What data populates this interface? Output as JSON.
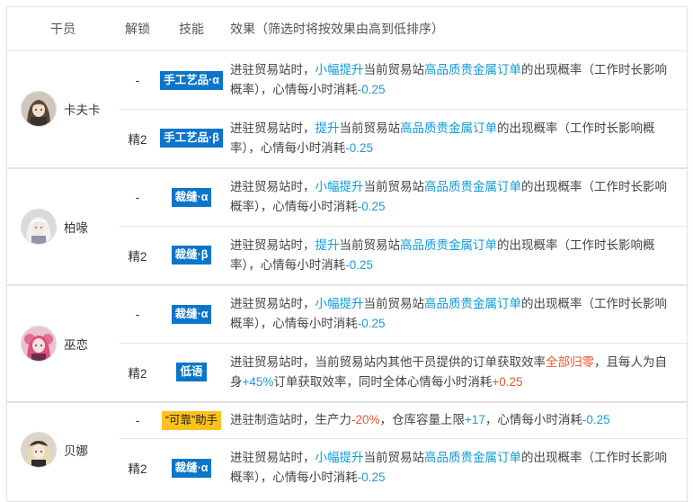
{
  "header": {
    "operator": "干员",
    "unlock": "解锁",
    "skill": "技能",
    "effect": "效果（筛选时将按效果由高到低排序）"
  },
  "colors": {
    "skill_badge": "#0b76c9",
    "special_badge": "#ffc21a",
    "highlight_blue": "#0e9bd8",
    "highlight_red": "#f0542f"
  },
  "operators": [
    {
      "name": "卡夫卡",
      "avatar_icon": "kafka-avatar-icon",
      "skills": [
        {
          "unlock": "-",
          "skill": "手工艺品·α",
          "badge": "blue",
          "effect": [
            {
              "t": "进驻贸易站时，"
            },
            {
              "t": "小幅提升",
              "c": "hl"
            },
            {
              "t": "当前贸易站"
            },
            {
              "t": "高品质贵金属订单",
              "c": "hl"
            },
            {
              "t": "的出现概率（工作时长影响概率），心情每小时消耗"
            },
            {
              "t": "-0.25",
              "c": "num"
            }
          ]
        },
        {
          "unlock": "精2",
          "skill": "手工艺品·β",
          "badge": "blue",
          "effect": [
            {
              "t": "进驻贸易站时，"
            },
            {
              "t": "提升",
              "c": "hl"
            },
            {
              "t": "当前贸易站"
            },
            {
              "t": "高品质贵金属订单",
              "c": "hl"
            },
            {
              "t": "的出现概率（工作时长影响概率），心情每小时消耗"
            },
            {
              "t": "-0.25",
              "c": "num"
            }
          ]
        }
      ]
    },
    {
      "name": "柏喙",
      "avatar_icon": "bibeak-avatar-icon",
      "skills": [
        {
          "unlock": "-",
          "skill": "裁缝·α",
          "badge": "blue",
          "effect": [
            {
              "t": "进驻贸易站时，"
            },
            {
              "t": "小幅提升",
              "c": "hl"
            },
            {
              "t": "当前贸易站"
            },
            {
              "t": "高品质贵金属订单",
              "c": "hl"
            },
            {
              "t": "的出现概率（工作时长影响概率），心情每小时消耗"
            },
            {
              "t": "-0.25",
              "c": "num"
            }
          ]
        },
        {
          "unlock": "精2",
          "skill": "裁缝·β",
          "badge": "blue",
          "effect": [
            {
              "t": "进驻贸易站时，"
            },
            {
              "t": "提升",
              "c": "hl"
            },
            {
              "t": "当前贸易站"
            },
            {
              "t": "高品质贵金属订单",
              "c": "hl"
            },
            {
              "t": "的出现概率（工作时长影响概率），心情每小时消耗"
            },
            {
              "t": "-0.25",
              "c": "num"
            }
          ]
        }
      ]
    },
    {
      "name": "巫恋",
      "avatar_icon": "shamare-avatar-icon",
      "skills": [
        {
          "unlock": "-",
          "skill": "裁缝·α",
          "badge": "blue",
          "effect": [
            {
              "t": "进驻贸易站时，"
            },
            {
              "t": "小幅提升",
              "c": "hl"
            },
            {
              "t": "当前贸易站"
            },
            {
              "t": "高品质贵金属订单",
              "c": "hl"
            },
            {
              "t": "的出现概率（工作时长影响概率），心情每小时消耗"
            },
            {
              "t": "-0.25",
              "c": "num"
            }
          ]
        },
        {
          "unlock": "精2",
          "skill": "低语",
          "badge": "blue",
          "effect": [
            {
              "t": "进驻贸易站时，当前贸易站内其他干员提供的订单获取效率"
            },
            {
              "t": "全部归零",
              "c": "red"
            },
            {
              "t": "，且每人为自身"
            },
            {
              "t": "+45%",
              "c": "num"
            },
            {
              "t": "订单获取效率，同时全体心情每小时消耗"
            },
            {
              "t": "+0.25",
              "c": "red"
            }
          ]
        }
      ]
    },
    {
      "name": "贝娜",
      "avatar_icon": "beanstalk-avatar-icon",
      "skills": [
        {
          "unlock": "-",
          "skill": "“可靠”助手",
          "badge": "yellow",
          "effect": [
            {
              "t": "进驻制造站时，生产力"
            },
            {
              "t": "-20%",
              "c": "red"
            },
            {
              "t": "，仓库容量上限"
            },
            {
              "t": "+17",
              "c": "num"
            },
            {
              "t": "，心情每小时消耗"
            },
            {
              "t": "-0.25",
              "c": "num"
            }
          ]
        },
        {
          "unlock": "精2",
          "skill": "裁缝·α",
          "badge": "blue",
          "effect": [
            {
              "t": "进驻贸易站时，"
            },
            {
              "t": "小幅提升",
              "c": "hl"
            },
            {
              "t": "当前贸易站"
            },
            {
              "t": "高品质贵金属订单",
              "c": "hl"
            },
            {
              "t": "的出现概率（工作时长影响概率），心情每小时消耗"
            },
            {
              "t": "-0.25",
              "c": "num"
            }
          ]
        }
      ]
    }
  ]
}
